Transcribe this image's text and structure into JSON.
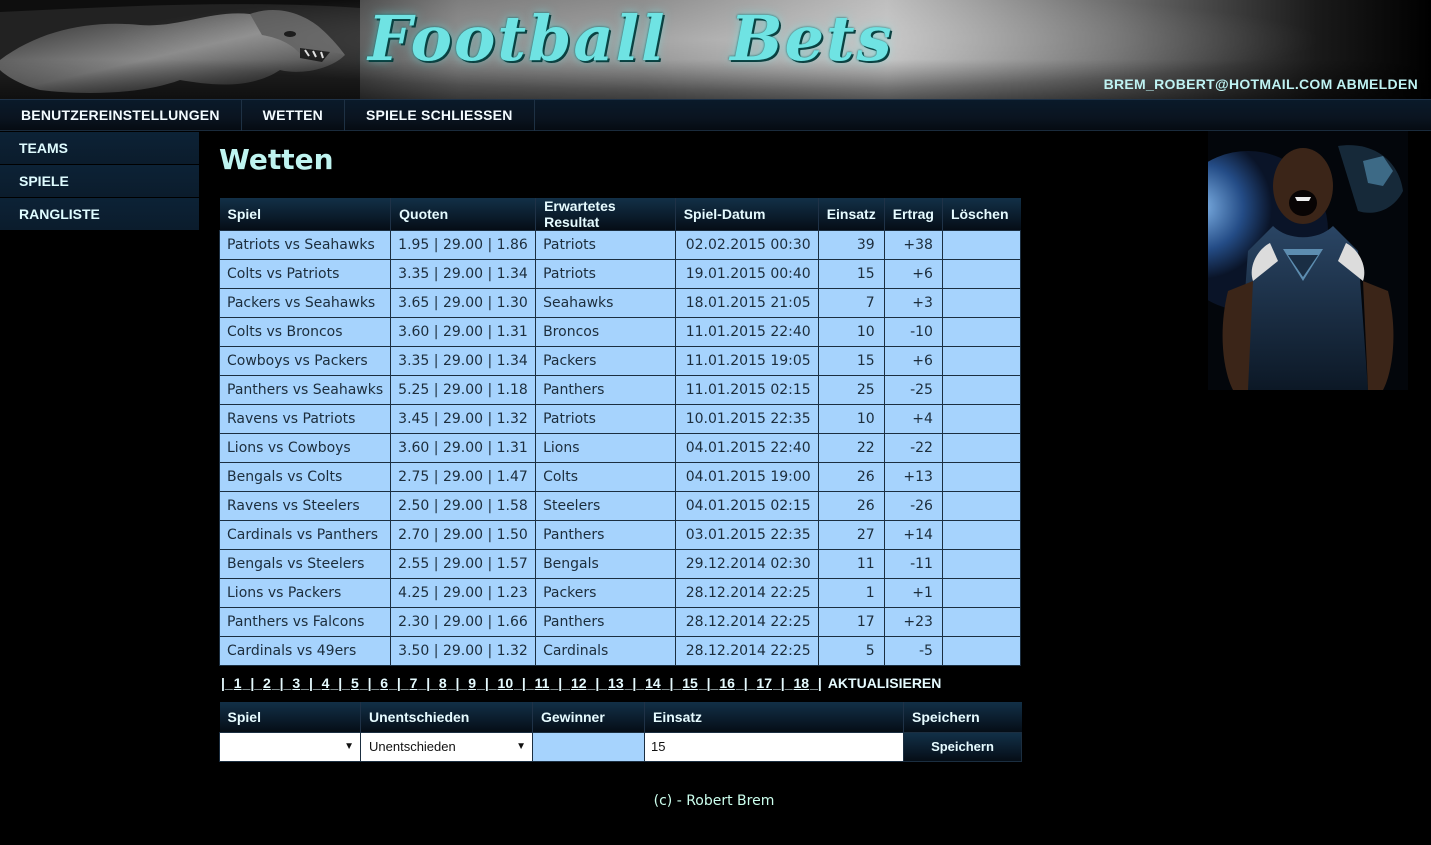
{
  "header": {
    "logo": "Football   Bets",
    "user_email": "BREM_ROBERT@HOTMAIL.COM",
    "logout_label": "ABMELDEN"
  },
  "topnav": {
    "items": [
      "BENUTZEREINSTELLUNGEN",
      "WETTEN",
      "SPIELE SCHLIESSEN"
    ]
  },
  "sidenav": {
    "items": [
      "TEAMS",
      "SPIELE",
      "RANGLISTE"
    ]
  },
  "page": {
    "title": "Wetten"
  },
  "bets": {
    "columns": [
      "Spiel",
      "Quoten",
      "Erwartetes Resultat",
      "Spiel-Datum",
      "Einsatz",
      "Ertrag",
      "Löschen"
    ],
    "rows": [
      [
        "Patriots vs Seahawks",
        "1.95 | 29.00 | 1.86",
        "Patriots",
        "02.02.2015 00:30",
        "39",
        "+38",
        ""
      ],
      [
        "Colts vs Patriots",
        "3.35 | 29.00 | 1.34",
        "Patriots",
        "19.01.2015 00:40",
        "15",
        "+6",
        ""
      ],
      [
        "Packers vs Seahawks",
        "3.65 | 29.00 | 1.30",
        "Seahawks",
        "18.01.2015 21:05",
        "7",
        "+3",
        ""
      ],
      [
        "Colts vs Broncos",
        "3.60 | 29.00 | 1.31",
        "Broncos",
        "11.01.2015 22:40",
        "10",
        "-10",
        ""
      ],
      [
        "Cowboys vs Packers",
        "3.35 | 29.00 | 1.34",
        "Packers",
        "11.01.2015 19:05",
        "15",
        "+6",
        ""
      ],
      [
        "Panthers vs Seahawks",
        "5.25 | 29.00 | 1.18",
        "Panthers",
        "11.01.2015 02:15",
        "25",
        "-25",
        ""
      ],
      [
        "Ravens vs Patriots",
        "3.45 | 29.00 | 1.32",
        "Patriots",
        "10.01.2015 22:35",
        "10",
        "+4",
        ""
      ],
      [
        "Lions vs Cowboys",
        "3.60 | 29.00 | 1.31",
        "Lions",
        "04.01.2015 22:40",
        "22",
        "-22",
        ""
      ],
      [
        "Bengals vs Colts",
        "2.75 | 29.00 | 1.47",
        "Colts",
        "04.01.2015 19:00",
        "26",
        "+13",
        ""
      ],
      [
        "Ravens vs Steelers",
        "2.50 | 29.00 | 1.58",
        "Steelers",
        "04.01.2015 02:15",
        "26",
        "-26",
        ""
      ],
      [
        "Cardinals vs Panthers",
        "2.70 | 29.00 | 1.50",
        "Panthers",
        "03.01.2015 22:35",
        "27",
        "+14",
        ""
      ],
      [
        "Bengals vs Steelers",
        "2.55 | 29.00 | 1.57",
        "Bengals",
        "29.12.2014 02:30",
        "11",
        "-11",
        ""
      ],
      [
        "Lions vs Packers",
        "4.25 | 29.00 | 1.23",
        "Packers",
        "28.12.2014 22:25",
        "1",
        "+1",
        ""
      ],
      [
        "Panthers vs Falcons",
        "2.30 | 29.00 | 1.66",
        "Panthers",
        "28.12.2014 22:25",
        "17",
        "+23",
        ""
      ],
      [
        "Cardinals vs 49ers",
        "3.50 | 29.00 | 1.32",
        "Cardinals",
        "28.12.2014 22:25",
        "5",
        "-5",
        ""
      ]
    ]
  },
  "pager": {
    "pages": [
      "1",
      "2",
      "3",
      "4",
      "5",
      "6",
      "7",
      "8",
      "9",
      "10",
      "11",
      "12",
      "13",
      "14",
      "15",
      "16",
      "17",
      "18"
    ],
    "refresh_label": "AKTUALISIEREN"
  },
  "form": {
    "columns": [
      "Spiel",
      "Unentschieden",
      "Gewinner",
      "Einsatz",
      "Speichern"
    ],
    "game_value": "",
    "result_value": "Unentschieden",
    "winner_value": "",
    "stake_value": "15",
    "save_label": "Speichern"
  },
  "footer": {
    "text": "(c) - Robert Brem"
  },
  "icons": {
    "header_art": "panther-statue-image",
    "side_art": "player-superman-shirt-image"
  }
}
